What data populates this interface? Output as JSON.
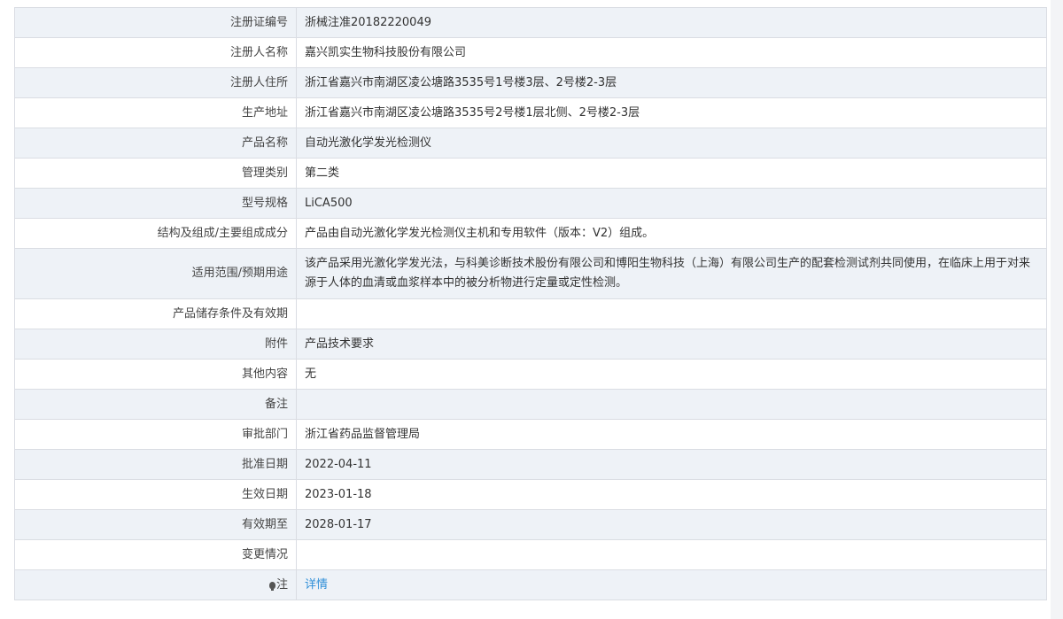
{
  "rows": [
    {
      "label": "注册证编号",
      "value": "浙械注准20182220049"
    },
    {
      "label": "注册人名称",
      "value": "嘉兴凯实生物科技股份有限公司"
    },
    {
      "label": "注册人住所",
      "value": "浙江省嘉兴市南湖区凌公塘路3535号1号楼3层、2号楼2-3层"
    },
    {
      "label": "生产地址",
      "value": "浙江省嘉兴市南湖区凌公塘路3535号2号楼1层北侧、2号楼2-3层"
    },
    {
      "label": "产品名称",
      "value": "自动光激化学发光检测仪"
    },
    {
      "label": "管理类别",
      "value": "第二类"
    },
    {
      "label": "型号规格",
      "value": "LiCA500"
    },
    {
      "label": "结构及组成/主要组成成分",
      "value": "产品由自动光激化学发光检测仪主机和专用软件（版本：V2）组成。"
    },
    {
      "label": "适用范围/预期用途",
      "value": "该产品采用光激化学发光法，与科美诊断技术股份有限公司和博阳生物科技（上海）有限公司生产的配套检测试剂共同使用，在临床上用于对来源于人体的血清或血浆样本中的被分析物进行定量或定性检测。"
    },
    {
      "label": "产品储存条件及有效期",
      "value": ""
    },
    {
      "label": "附件",
      "value": "产品技术要求"
    },
    {
      "label": "其他内容",
      "value": "无"
    },
    {
      "label": "备注",
      "value": ""
    },
    {
      "label": "审批部门",
      "value": "浙江省药品监督管理局"
    },
    {
      "label": "批准日期",
      "value": "2022-04-11"
    },
    {
      "label": "生效日期",
      "value": "2023-01-18"
    },
    {
      "label": "有效期至",
      "value": "2028-01-17"
    },
    {
      "label": "变更情况",
      "value": ""
    }
  ],
  "note_row": {
    "label": "注",
    "icon": "lightbulb-icon",
    "link": "详情"
  },
  "colors": {
    "shade": "#eef2f7",
    "border": "#dadde3",
    "link": "#2f8fd8"
  }
}
